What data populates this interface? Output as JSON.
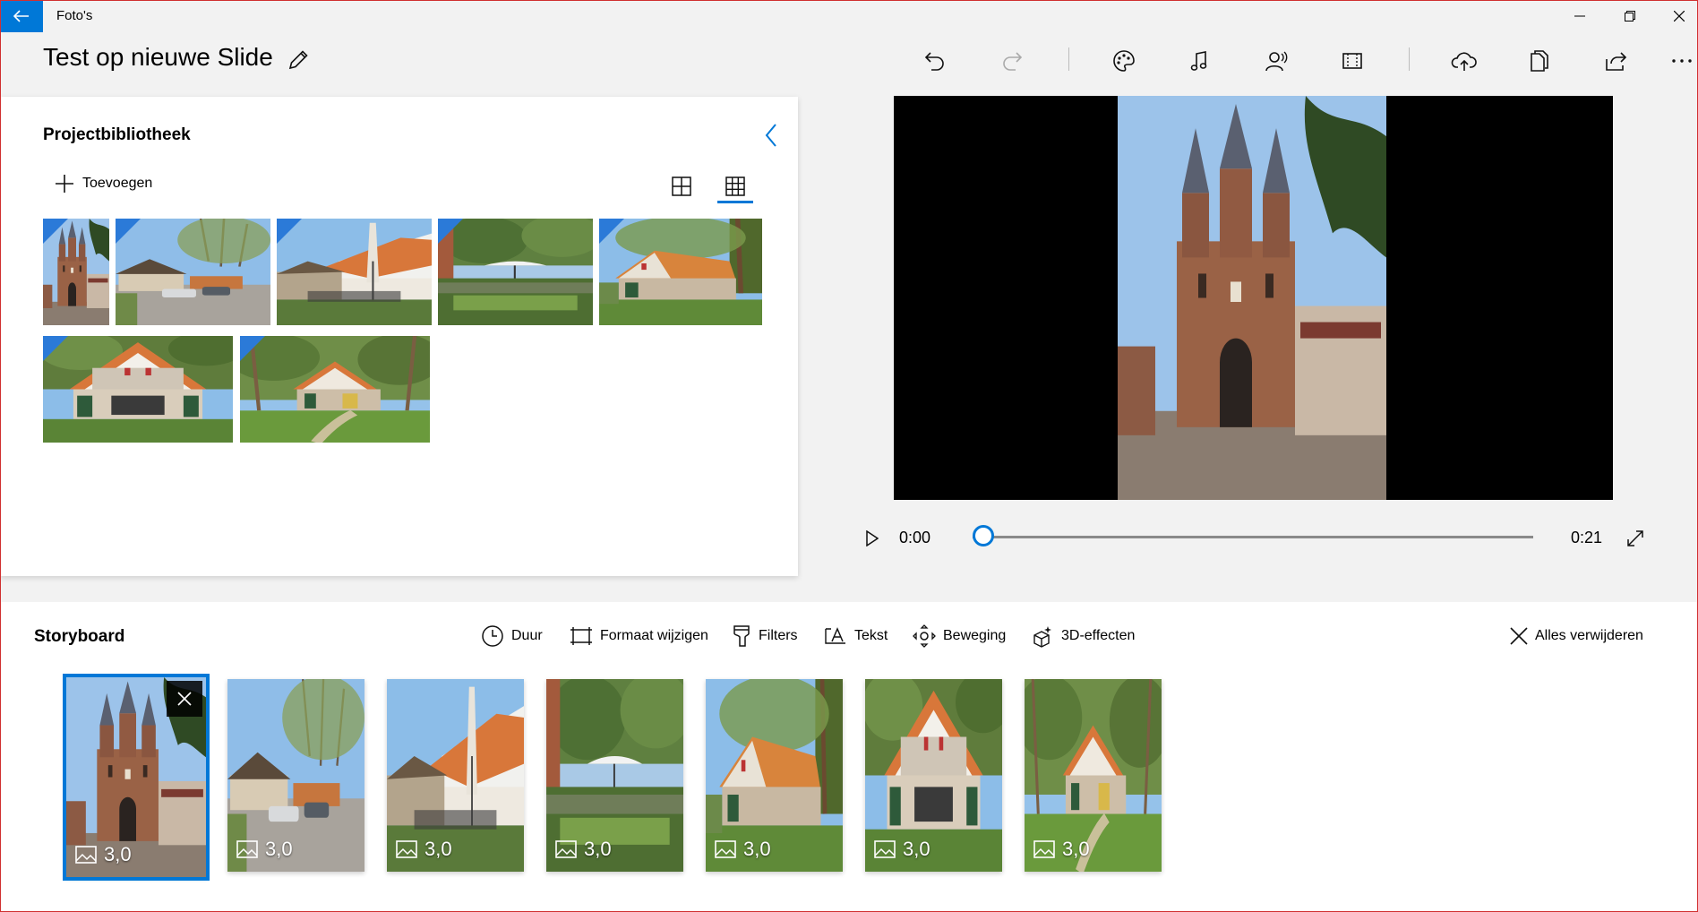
{
  "app": {
    "title": "Foto's"
  },
  "project": {
    "title": "Test op nieuwe Slide"
  },
  "library": {
    "title": "Projectbibliotheek",
    "add_label": "Toevoegen",
    "items": [
      {
        "scene": "tower"
      },
      {
        "scene": "parking"
      },
      {
        "scene": "terrace"
      },
      {
        "scene": "garden"
      },
      {
        "scene": "cottage"
      },
      {
        "scene": "cottage_front"
      },
      {
        "scene": "cottage_far"
      }
    ]
  },
  "player": {
    "current_time": "0:00",
    "total_time": "0:21",
    "progress": 0
  },
  "storyboard": {
    "title": "Storyboard",
    "tools": [
      {
        "label": "Duur",
        "icon": "clock-icon"
      },
      {
        "label": "Formaat wijzigen",
        "icon": "resize-icon"
      },
      {
        "label": "Filters",
        "icon": "filter-icon"
      },
      {
        "label": "Tekst",
        "icon": "text-icon"
      },
      {
        "label": "Beweging",
        "icon": "motion-icon"
      },
      {
        "label": "3D-effecten",
        "icon": "effects-3d-icon"
      }
    ],
    "remove_all_label": "Alles verwijderen",
    "clips": [
      {
        "duration": "3,0",
        "scene": "tower",
        "selected": true
      },
      {
        "duration": "3,0",
        "scene": "parking"
      },
      {
        "duration": "3,0",
        "scene": "terrace"
      },
      {
        "duration": "3,0",
        "scene": "garden"
      },
      {
        "duration": "3,0",
        "scene": "cottage"
      },
      {
        "duration": "3,0",
        "scene": "cottage_front"
      },
      {
        "duration": "3,0",
        "scene": "cottage_far"
      }
    ]
  },
  "colors": {
    "accent": "#0078d7",
    "corner_badge": "#2b7ad8"
  }
}
